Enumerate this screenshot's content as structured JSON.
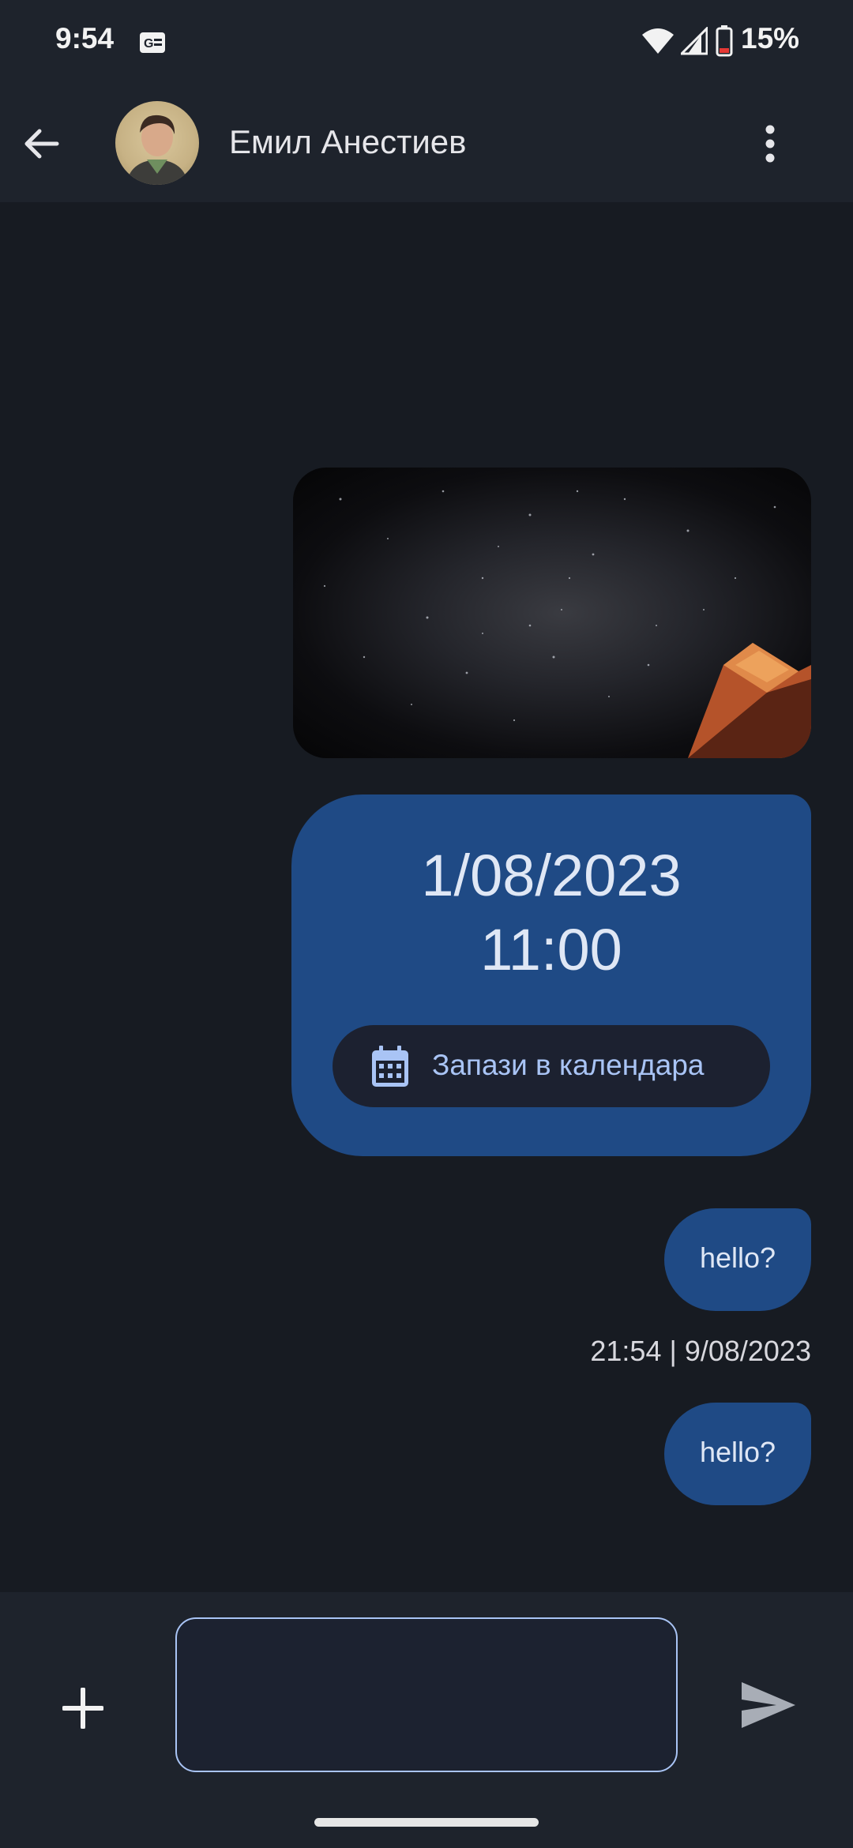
{
  "status_bar": {
    "time": "9:54",
    "battery_percent": "15%",
    "icons": [
      "news-notification-icon",
      "wifi-icon",
      "cell-signal-icon",
      "battery-low-icon"
    ]
  },
  "header": {
    "contact_name": "Емил Анестиев",
    "icons": [
      "back-arrow-icon",
      "avatar",
      "more-vert-icon"
    ]
  },
  "messages": {
    "event": {
      "date": "1/08/2023",
      "time": "11:00",
      "save_button_label": "Запази в календара",
      "icon": "calendar-icon"
    },
    "texts": [
      {
        "text": "hello?"
      },
      {
        "text": "hello?"
      }
    ],
    "timestamp": "21:54 | 9/08/2023"
  },
  "composer": {
    "input_value": "",
    "icons": [
      "add-icon",
      "send-icon"
    ]
  },
  "colors": {
    "background": "#171b22",
    "bar": "#1e232c",
    "bubble": "#1f4a85",
    "accent": "#a9c4f5"
  }
}
